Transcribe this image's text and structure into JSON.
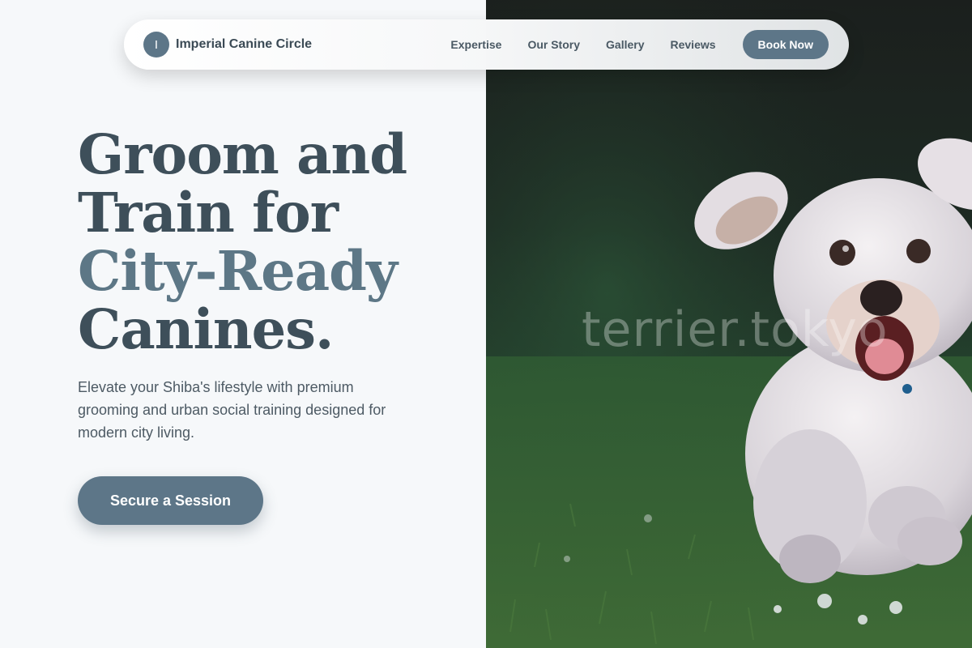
{
  "nav": {
    "brand_initial": "I",
    "brand_name": "Imperial Canine Circle",
    "links": [
      "Expertise",
      "Our Story",
      "Gallery",
      "Reviews"
    ],
    "cta_label": "Book Now"
  },
  "hero": {
    "title_line1": "Groom and",
    "title_line2": "Train for",
    "title_accent": "City-Ready",
    "title_line4": "Canines.",
    "subtitle": "Elevate your Shiba's lifestyle with premium grooming and urban social training designed for modern city living.",
    "cta_label": "Secure a Session"
  },
  "photo": {
    "watermark": "terrier.tokyo",
    "subject": "white-fluffy-dog-running-on-grass"
  },
  "colors": {
    "accent": "#5d7688",
    "heading": "#3e4f5a",
    "heading_accent": "#5d7786",
    "background": "#f6f8fa"
  }
}
